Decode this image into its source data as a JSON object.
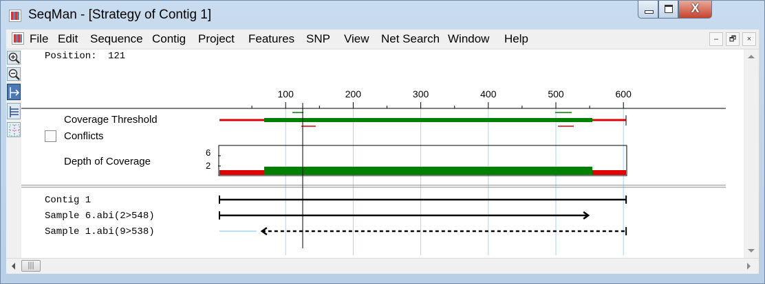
{
  "window": {
    "title": "SeqMan - [Strategy of Contig 1]",
    "close_glyph": "X"
  },
  "menu": [
    "File",
    "Edit",
    "Sequence",
    "Contig",
    "Project",
    "Features",
    "SNP",
    "View",
    "Net Search",
    "Window",
    "Help"
  ],
  "mdi_buttons": {
    "minimize": "–",
    "restore": "🗗",
    "close": "×"
  },
  "toolbar": {
    "icons": [
      "zoom-in-icon",
      "zoom-out-icon",
      "fit-horizontal-icon",
      "fit-all-icon",
      "grid-icon"
    ]
  },
  "view": {
    "position_label": "Position:",
    "position_value": "121",
    "ruler": {
      "ticks": [
        "100",
        "200",
        "300",
        "400",
        "500",
        "600"
      ],
      "range": [
        1,
        604
      ]
    },
    "tracks": {
      "coverage_threshold": "Coverage Threshold",
      "conflicts": "Conflicts",
      "depth_of_coverage": "Depth of Coverage",
      "depth_ticks": [
        "6",
        "2"
      ]
    },
    "sequences": [
      {
        "label": "Contig 1",
        "start": 2,
        "end": 604,
        "direction": "both"
      },
      {
        "label": "Sample 6.abi(2>548)",
        "start": 2,
        "end": 548,
        "direction": "forward"
      },
      {
        "label": "Sample 1.abi(9>538)",
        "start": 65,
        "end": 604,
        "direction": "reverse"
      }
    ]
  },
  "colors": {
    "low_coverage": "#e00000",
    "good_coverage": "#008000",
    "guide_line": "#9fd9ee"
  },
  "hscroll_grip": "|||"
}
